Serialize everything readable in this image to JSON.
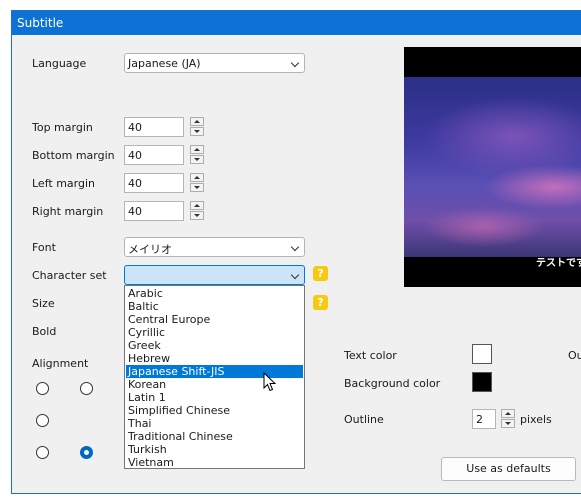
{
  "window": {
    "title": "Subtitle"
  },
  "labels": {
    "language": "Language",
    "top_margin": "Top margin",
    "bottom_margin": "Bottom margin",
    "left_margin": "Left margin",
    "right_margin": "Right margin",
    "font": "Font",
    "character_set": "Character set",
    "size": "Size",
    "bold": "Bold",
    "alignment": "Alignment",
    "text_color": "Text color",
    "background_color": "Background color",
    "outline": "Outline",
    "pixels": "pixels",
    "cut_off": "Ou"
  },
  "fields": {
    "language": "Japanese (JA)",
    "top_margin": "40",
    "bottom_margin": "40",
    "left_margin": "40",
    "right_margin": "40",
    "font": "メイリオ",
    "character_set": "",
    "outline": "2"
  },
  "help_glyph": "?",
  "character_set_options": [
    "Arabic",
    "Baltic",
    "Central Europe",
    "Cyrillic",
    "Greek",
    "Hebrew",
    "Japanese Shift-JIS",
    "Korean",
    "Latin 1",
    "Simplified Chinese",
    "Thai",
    "Traditional Chinese",
    "Turkish",
    "Vietnam"
  ],
  "highlighted_option": "Japanese Shift-JIS",
  "alignment_selected": "bottom-center",
  "preview": {
    "subtitle_text": "テストです"
  },
  "colors": {
    "text_color": "#ffffff",
    "background_color": "#000000",
    "accent": "#0078d7",
    "titlebar": "#0d72d6"
  },
  "buttons": {
    "use_as_defaults": "Use as defaults"
  },
  "icons": {
    "help": "question-icon",
    "cursor": "mouse-pointer-icon",
    "dropdown": "chevron-down-icon"
  }
}
